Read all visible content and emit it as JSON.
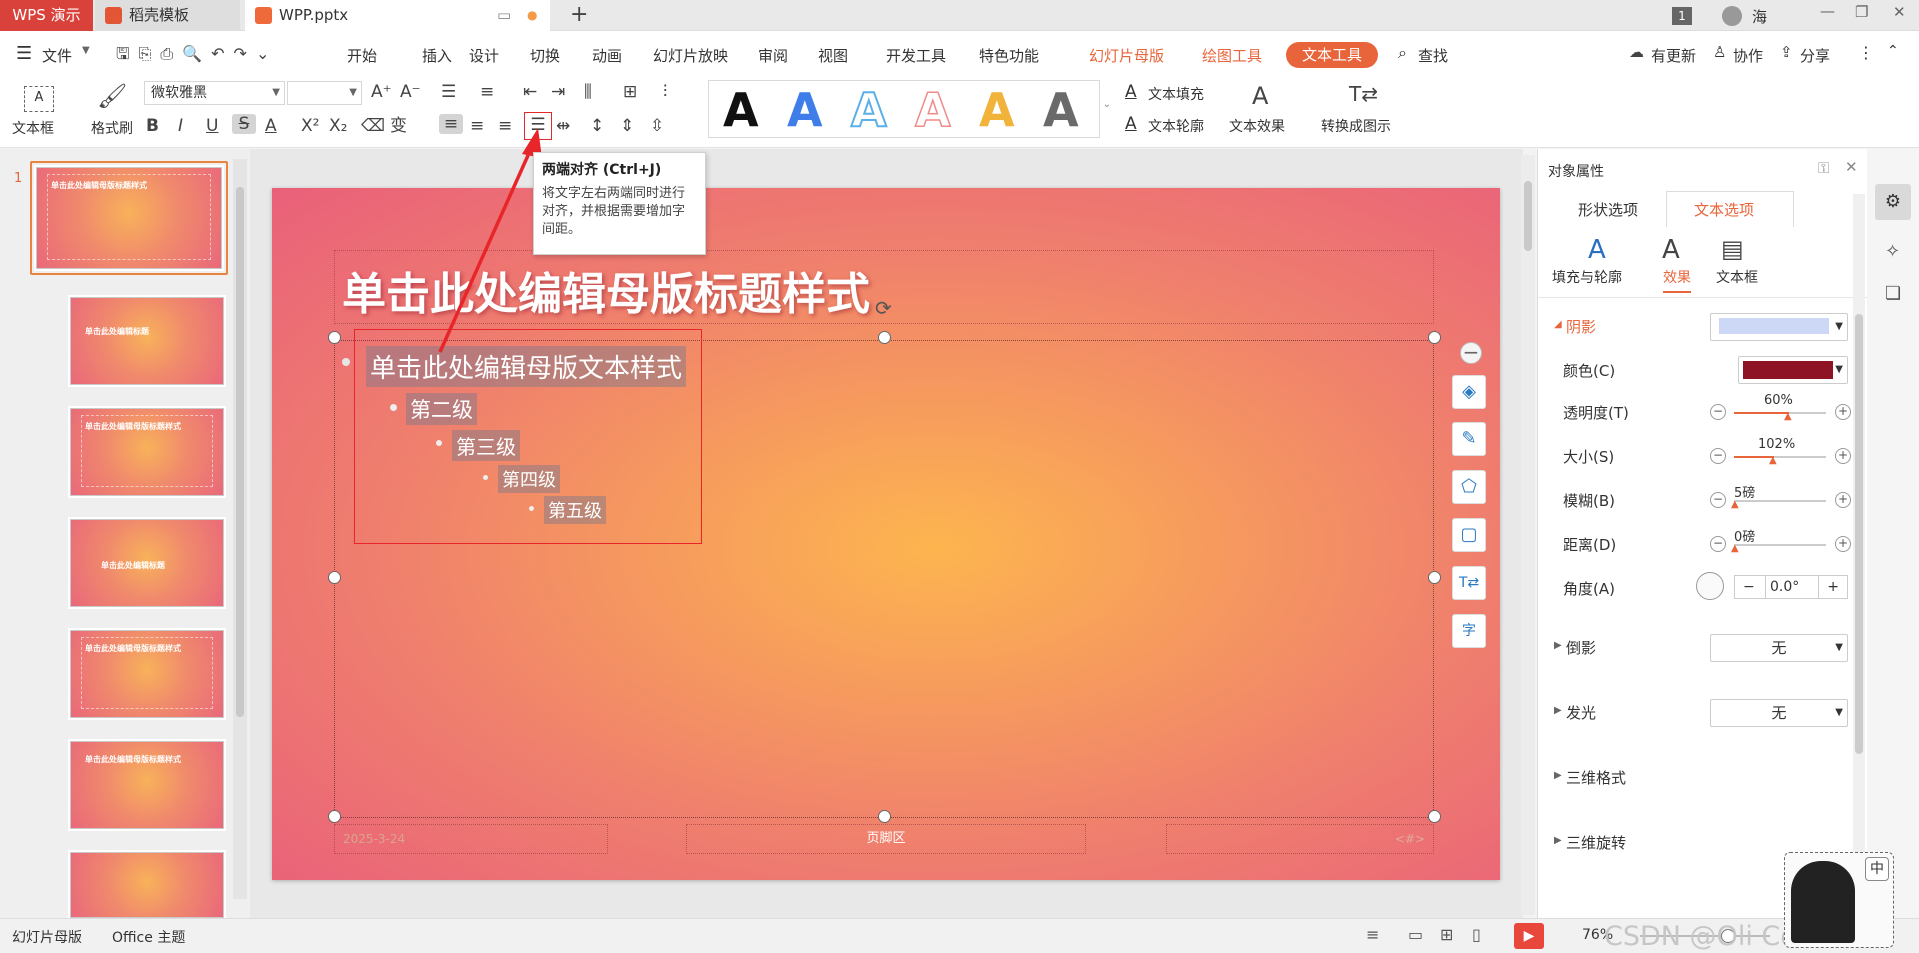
{
  "tabs": {
    "app": "WPS 演示",
    "template": "稻壳模板",
    "file": "WPP.pptx",
    "badge_count": "1",
    "user": "海"
  },
  "menu": {
    "file": "文件",
    "items": [
      "开始",
      "插入",
      "设计",
      "切换",
      "动画",
      "幻灯片放映",
      "审阅",
      "视图",
      "开发工具",
      "特色功能"
    ],
    "context_items": [
      "幻灯片母版",
      "绘图工具"
    ],
    "active": "文本工具",
    "search": "查找",
    "update": "有更新",
    "collab": "协作",
    "share": "分享"
  },
  "toolbar": {
    "textbox": "文本框",
    "format_painter": "格式刷",
    "font_name": "微软雅黑",
    "font_size": "",
    "text_fill": "文本填充",
    "text_outline": "文本轮廓",
    "text_effect": "文本效果",
    "convert": "转换成图示",
    "gallery_letter": "A"
  },
  "tooltip": {
    "title": "两端对齐 (Ctrl+J)",
    "body": "将文字左右两端同时进行对齐，并根据需要增加字间距。"
  },
  "slide": {
    "title": "单击此处编辑母版标题样式",
    "level1": "单击此处编辑母版文本样式",
    "level2": "第二级",
    "level3": "第三级",
    "level4": "第四级",
    "level5": "第五级",
    "date": "2025-3-24",
    "footer": "页脚区",
    "number": "<#>"
  },
  "thumbnails": [
    {
      "num": "1",
      "title": "单击此处编辑母版标题样式"
    },
    {
      "title": "单击此处编辑标题"
    },
    {
      "title": "单击此处编辑母版标题样式"
    },
    {
      "title": "单击此处编辑标题"
    },
    {
      "title": "单击此处编辑母版标题样式"
    },
    {
      "title": "单击此处编辑母版标题样式"
    },
    {
      "title": ""
    }
  ],
  "panel": {
    "header": "对象属性",
    "tab_shape": "形状选项",
    "tab_text": "文本选项",
    "sub_fill": "填充与轮廓",
    "sub_effect": "效果",
    "sub_textbox": "文本框",
    "shadow": "阴影",
    "color": "颜色(C)",
    "transparency": "透明度(T)",
    "transparency_val": "60%",
    "size": "大小(S)",
    "size_val": "102%",
    "blur": "模糊(B)",
    "blur_val": "5磅",
    "distance": "距离(D)",
    "distance_val": "0磅",
    "angle": "角度(A)",
    "angle_val": "0.0°",
    "reflection": "倒影",
    "reflection_val": "无",
    "glow": "发光",
    "glow_val": "无",
    "bevel": "三维格式",
    "rotation": "三维旋转",
    "shadow_color": "#8e1425",
    "shadow_swatch": "#cdd8f7"
  },
  "status": {
    "view": "幻灯片母版",
    "theme": "Office 主题",
    "zoom": "76%",
    "ime": "中",
    "watermark": "CSDN @Oli Correct"
  },
  "colors": {
    "accent": "#e8643a",
    "wps_red": "#d9413b"
  }
}
